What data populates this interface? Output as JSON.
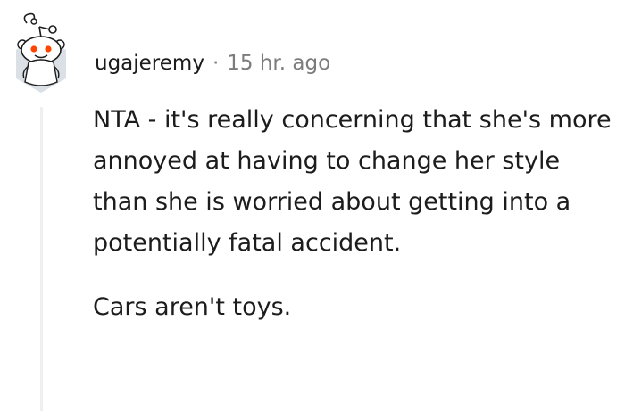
{
  "comment": {
    "avatar_icon": "snoo-avatar-icon",
    "username": "ugajeremy",
    "separator": "·",
    "timestamp": "15 hr. ago",
    "paragraphs": [
      "NTA - it's really concerning that she's more annoyed at having to change her style than she is worried about getting into a potentially fatal accident.",
      "Cars aren't toys."
    ]
  },
  "colors": {
    "text": "#1c1c1c",
    "meta": "#7c7c7c",
    "avatar_bg": "#dae0e6",
    "snoo_eye": "#ff4500",
    "thread_line": "#edeff1"
  }
}
